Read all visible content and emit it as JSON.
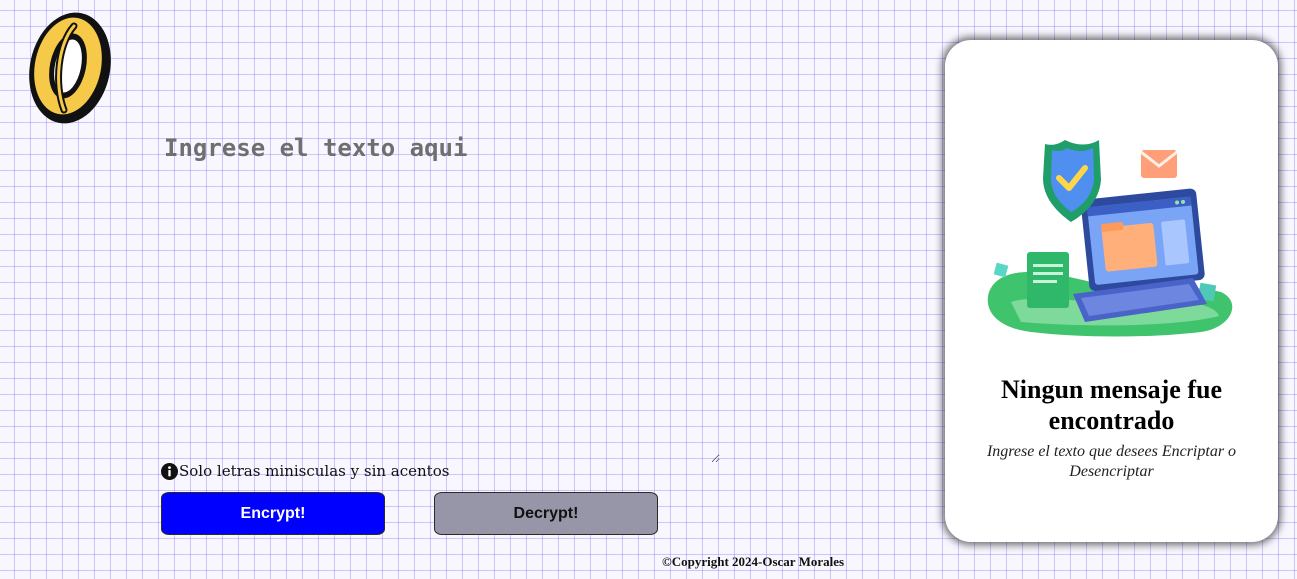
{
  "input": {
    "placeholder": "Ingrese el texto aqui",
    "value": ""
  },
  "hint": {
    "icon": "info-icon",
    "text": "Solo letras minisculas y sin acentos"
  },
  "buttons": {
    "encrypt_label": "Encrypt!",
    "decrypt_label": "Decrypt!"
  },
  "result_panel": {
    "title": "Ningun mensaje fue encontrado",
    "subtitle": "Ingrese el texto que desees Encriptar o Desencriptar"
  },
  "footer": {
    "text": "©Copyright 2024-Oscar Morales"
  },
  "colors": {
    "encrypt_button": "#0000ff",
    "decrypt_button": "#9696a8",
    "logo_yellow": "#f7c948",
    "background": "#f8f6ff"
  }
}
